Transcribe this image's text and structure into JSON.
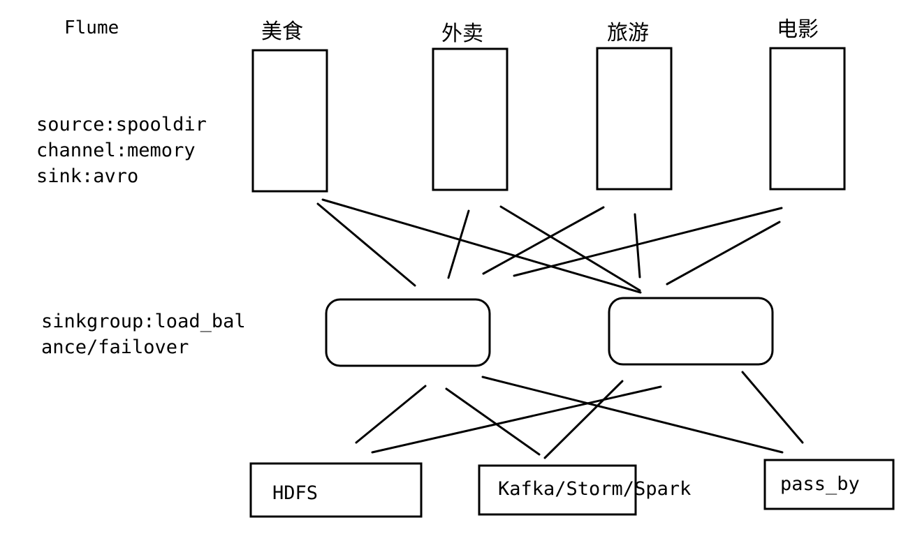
{
  "title": "Flume",
  "config_lines": [
    "source:spooldir",
    "channel:memory",
    "sink:avro"
  ],
  "sinkgroup_lines": [
    "sinkgroup:load_bal",
    "ance/failover"
  ],
  "sources": [
    {
      "label": "美食"
    },
    {
      "label": "外卖"
    },
    {
      "label": "旅游"
    },
    {
      "label": "电影"
    }
  ],
  "collectors": [
    {
      "label": ""
    },
    {
      "label": ""
    }
  ],
  "destinations": [
    {
      "label": "HDFS"
    },
    {
      "label": "Kafka/Storm/Spark"
    },
    {
      "label": "pass_by"
    }
  ]
}
